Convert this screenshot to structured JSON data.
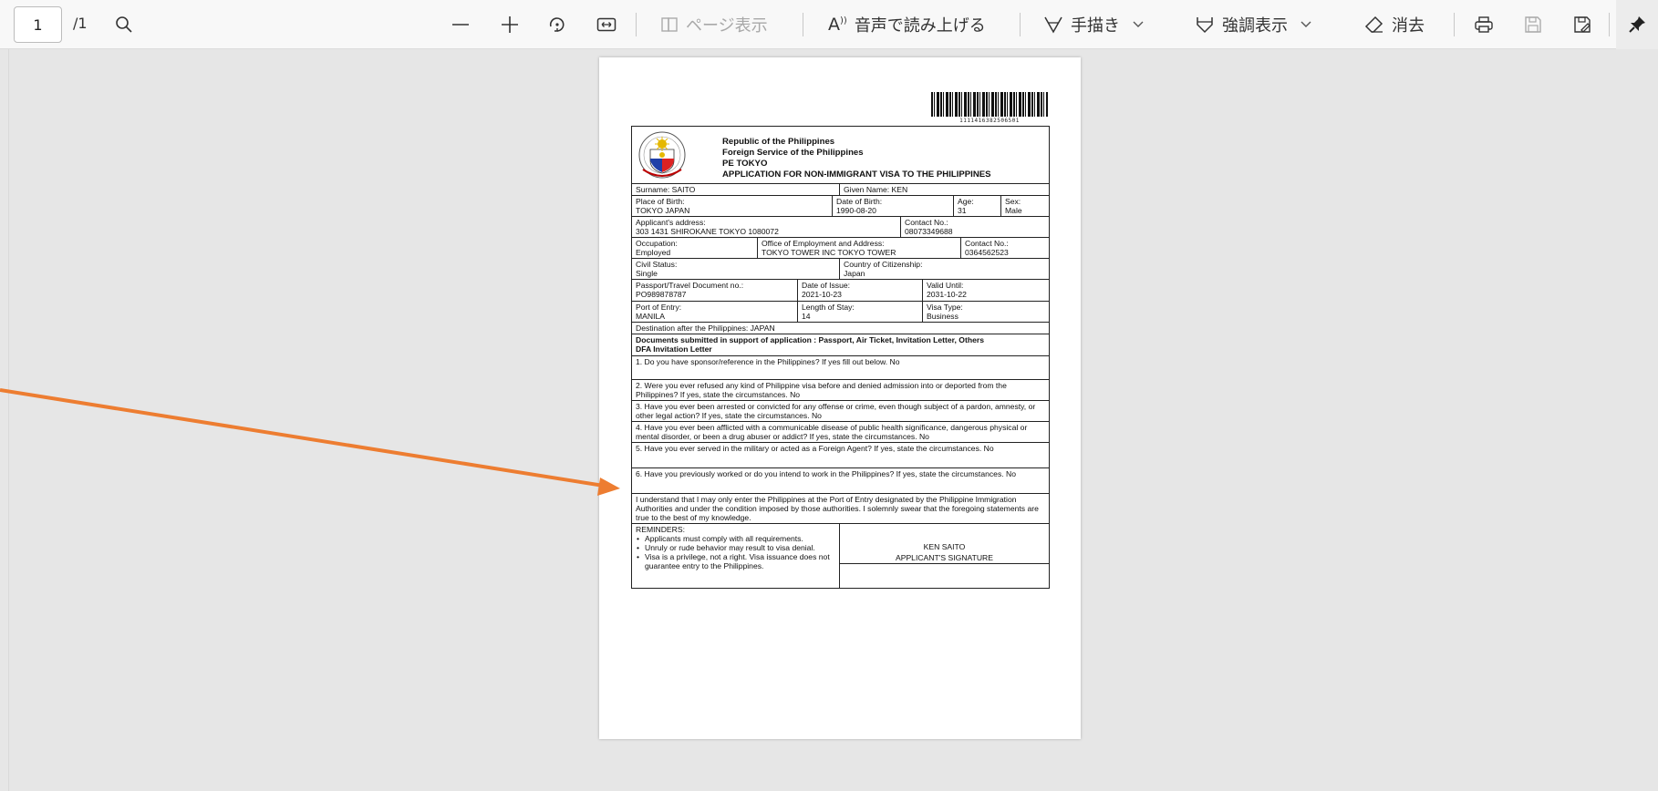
{
  "toolbar": {
    "page_current": "1",
    "page_total": "/1",
    "page_view_label": "ページ表示",
    "read_aloud_label": "音声で読み上げる",
    "draw_label": "手描き",
    "highlight_label": "強調表示",
    "erase_label": "消去"
  },
  "document": {
    "barcode_number": "1111416382506501",
    "header": {
      "line1": "Republic of the Philippines",
      "line2": "Foreign Service of the Philippines",
      "line3": "PE TOKYO",
      "line4": "APPLICATION FOR NON-IMMIGRANT VISA TO THE PHILIPPINES"
    },
    "surname": "Surname: SAITO",
    "given_name": "Given Name: KEN",
    "place_of_birth_label": "Place of Birth:",
    "place_of_birth": "TOKYO JAPAN",
    "dob_label": "Date of Birth:",
    "dob": "1990-08-20",
    "age_label": "Age:",
    "age": "31",
    "sex_label": "Sex:",
    "sex": "Male",
    "address_label": "Applicant's address:",
    "address": "303 1431 SHIROKANE TOKYO 1080072",
    "contact_label": "Contact No.:",
    "contact": "08073349688",
    "occupation_label": "Occupation:",
    "occupation": "Employed",
    "office_label": "Office of Employment and Address:",
    "office": "TOKYO TOWER INC TOKYO TOWER",
    "office_contact_label": "Contact No.:",
    "office_contact": "0364562523",
    "civil_status_label": "Civil Status:",
    "civil_status": "Single",
    "citizenship_label": "Country of Citizenship:",
    "citizenship": "Japan",
    "passport_label": "Passport/Travel Document no.:",
    "passport": "PO989878787",
    "issue_label": "Date of Issue:",
    "issue": "2021-10-23",
    "valid_label": "Valid Until:",
    "valid": "2031-10-22",
    "entry_label": "Port of Entry:",
    "entry": "MANILA",
    "stay_label": "Length of Stay:",
    "stay": "14",
    "visa_label": "Visa Type:",
    "visa": "Business",
    "destination": "Destination after the Philippines: JAPAN",
    "documents_line1": "Documents submitted in support of application : Passport, Air Ticket, Invitation Letter, Others",
    "documents_line2": "DFA Invitation Letter",
    "q1": "1. Do you have sponsor/reference in the Philippines? If yes fill out below. No",
    "q2": "2. Were you ever refused any kind of Philippine visa before and denied admission into or deported from the Philippines? If yes, state the circumstances. No",
    "q3": "3. Have you ever been arrested or convicted for any offense or crime, even though subject of a pardon, amnesty, or other legal action? If yes, state the circumstances. No",
    "q4": "4. Have you ever been afflicted with a communicable disease of public health significance, dangerous physical or mental disorder, or been a drug abuser or addict? If yes, state the circumstances. No",
    "q5": "5. Have you ever served in the military or acted as a Foreign Agent? If yes, state the circumstances. No",
    "q6": "6. Have you previously worked or do you intend to work in the Philippines? If yes, state the circumstances. No",
    "declaration": "I understand that I may only enter the Philippines at the Port of Entry designated by the Philippine Immigration Authorities and under the condition imposed by those authorities. I solemnly swear that the foregoing statements are true to the best of my knowledge.",
    "reminders_title": "REMINDERS:",
    "reminders": [
      "Applicants must comply with all requirements.",
      "Unruly or rude behavior may result to visa denial.",
      "Visa is a privilege, not a right. Visa issuance does not guarantee entry to the Philippines."
    ],
    "signature_name": "KEN SAITO",
    "signature_label": "APPLICANT'S SIGNATURE"
  },
  "colors": {
    "arrow": "#ed7d31",
    "viewer_bg": "#e6e6e6",
    "toolbar_bg": "#f8f8f8"
  }
}
